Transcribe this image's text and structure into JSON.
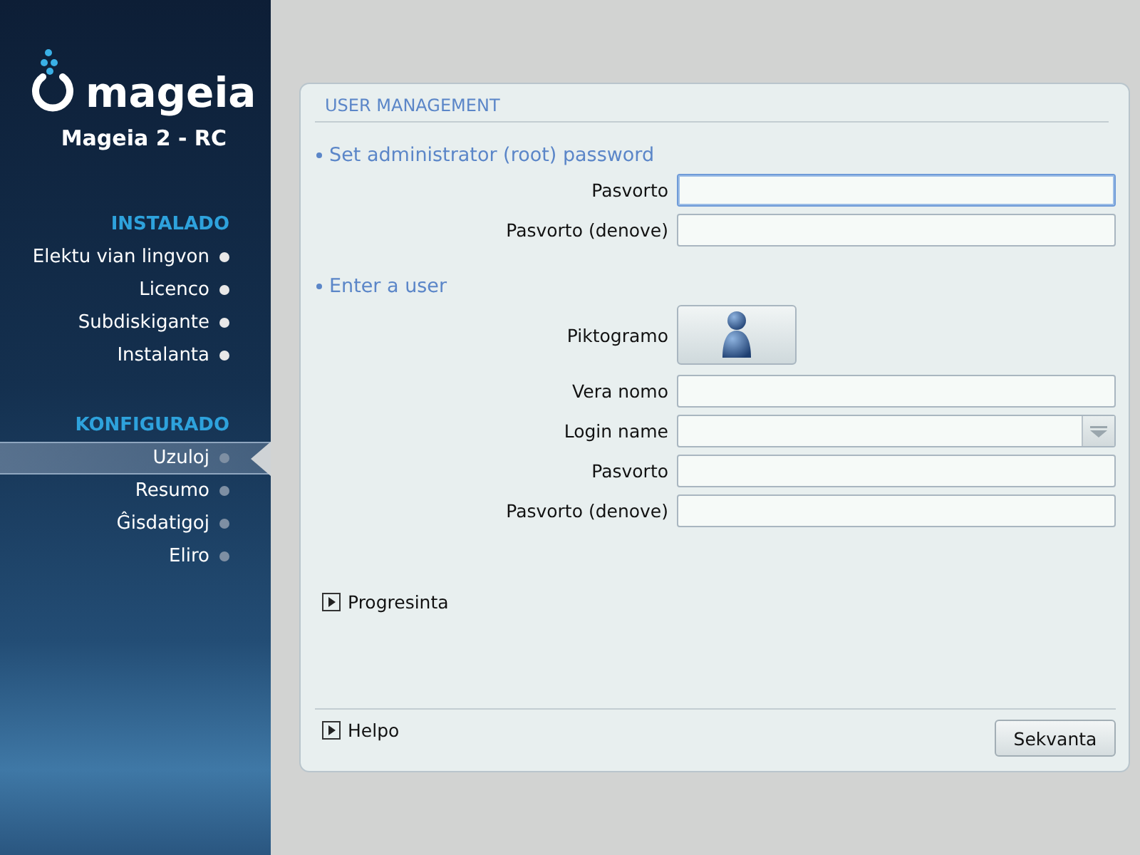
{
  "sidebar": {
    "logo_text": "mageia",
    "version": "Mageia 2 - RC",
    "sections": [
      {
        "title": "INSTALADO",
        "items": [
          {
            "label": "Elektu vian lingvon",
            "done": true,
            "selected": false
          },
          {
            "label": "Licenco",
            "done": true,
            "selected": false
          },
          {
            "label": "Subdiskigante",
            "done": true,
            "selected": false
          },
          {
            "label": "Instalanta",
            "done": true,
            "selected": false
          }
        ]
      },
      {
        "title": "KONFIGURADO",
        "items": [
          {
            "label": "Uzuloj",
            "done": false,
            "selected": true
          },
          {
            "label": "Resumo",
            "done": false,
            "selected": false
          },
          {
            "label": "Ĝisdatigoj",
            "done": false,
            "selected": false
          },
          {
            "label": "Eliro",
            "done": false,
            "selected": false
          }
        ]
      }
    ]
  },
  "panel": {
    "title": "USER MANAGEMENT",
    "sections": [
      {
        "heading": "Set administrator (root) password",
        "rows": [
          {
            "kind": "text",
            "label": "Pasvorto",
            "focused": true
          },
          {
            "kind": "text",
            "label": "Pasvorto (denove)",
            "focused": false
          }
        ]
      },
      {
        "heading": "Enter a user",
        "rows": [
          {
            "kind": "icon",
            "label": "Piktogramo"
          },
          {
            "kind": "text",
            "label": "Vera nomo",
            "focused": false
          },
          {
            "kind": "combo",
            "label": "Login name",
            "focused": false
          },
          {
            "kind": "text",
            "label": "Pasvorto",
            "focused": false
          },
          {
            "kind": "text",
            "label": "Pasvorto (denove)",
            "focused": false
          }
        ]
      }
    ],
    "expander": {
      "label": "Progresinta",
      "expanded": false
    },
    "help": {
      "label": "Helpo",
      "expanded": false
    },
    "next_button": "Sekvanta"
  }
}
